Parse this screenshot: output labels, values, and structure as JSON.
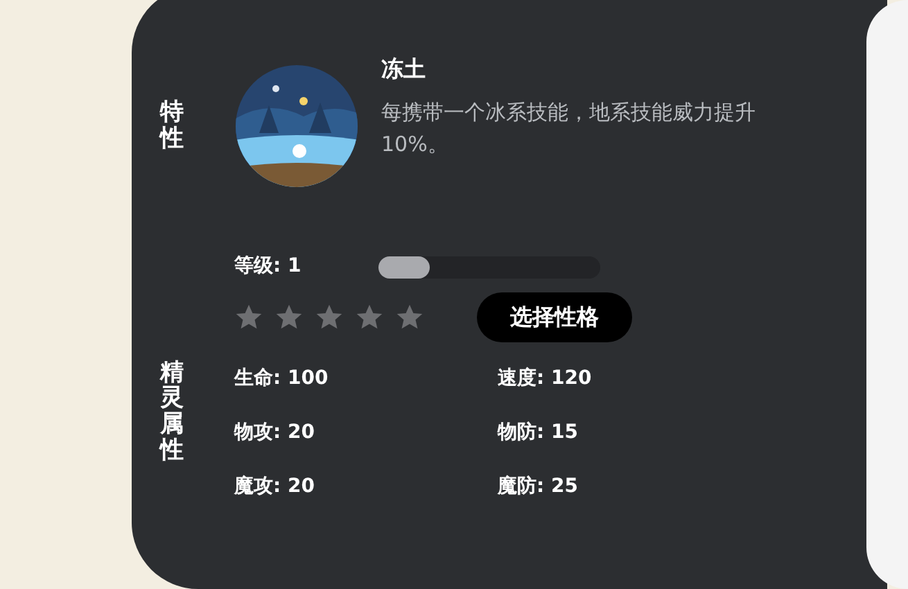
{
  "trait": {
    "section_label": "特性",
    "name": "冻土",
    "description": "每携带一个冰系技能，地系技能威力提升10%。"
  },
  "attributes": {
    "section_label": "精灵属性",
    "level_label": "等级: 1",
    "level": 0.23,
    "stars": 0,
    "nature_button": "选择性格",
    "stats": [
      {
        "label": "生命: 100"
      },
      {
        "label": "速度: 120"
      },
      {
        "label": "物攻: 20"
      },
      {
        "label": "物防: 15"
      },
      {
        "label": "魔攻: 20"
      },
      {
        "label": "魔防: 25"
      }
    ]
  }
}
